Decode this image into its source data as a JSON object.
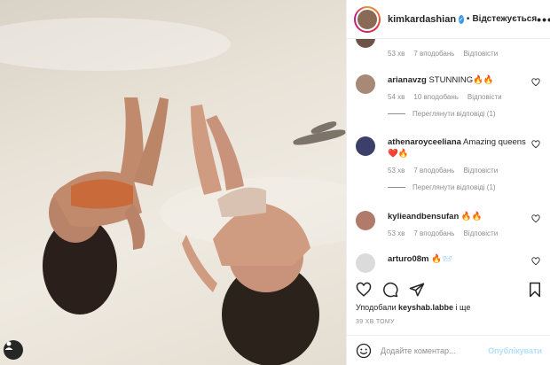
{
  "header": {
    "username": "kimkardashian",
    "separator": "•",
    "follow_label": "Відстежується",
    "more_label": "•••"
  },
  "comments": [
    {
      "username": "",
      "text": "",
      "age": "53 хв",
      "likes": "7 вподобань",
      "reply": "Відповісти",
      "avatar_color": "#6b5447"
    },
    {
      "username": "arianavzg",
      "text": "STUNNING🔥🔥",
      "age": "54 хв",
      "likes": "10 вподобань",
      "reply": "Відповісти",
      "view_replies": "Переглянути відповіді (1)",
      "avatar_color": "#a88876"
    },
    {
      "username": "athenaroyceeliana",
      "text": "Amazing queens❤️🔥",
      "age": "53 хв",
      "likes": "7 вподобань",
      "reply": "Відповісти",
      "view_replies": "Переглянути відповіді (1)",
      "avatar_color": "#3b3f6a"
    },
    {
      "username": "kylieandbensufan",
      "text": "🔥🔥",
      "age": "53 хв",
      "likes": "7 вподобань",
      "reply": "Відповісти",
      "avatar_color": "#b07b6a"
    },
    {
      "username": "arturo08m",
      "text": "🔥📨",
      "avatar_color": "#dbdbdb"
    }
  ],
  "likes": {
    "prefix": "Уподобали",
    "user": "keyshab.labbe",
    "suffix": "і ще"
  },
  "timestamp": "39 ХВ ТОМУ",
  "add_comment": {
    "placeholder": "Додайте коментар...",
    "post_label": "Опублікувати"
  },
  "colors": {
    "accent": "#3897f0",
    "post_disabled": "#b2dffc",
    "muted": "#8e8e8e"
  },
  "icons": [
    "heart-icon",
    "comment-icon",
    "share-icon",
    "bookmark-icon",
    "emoji-icon",
    "user-tag-icon"
  ]
}
